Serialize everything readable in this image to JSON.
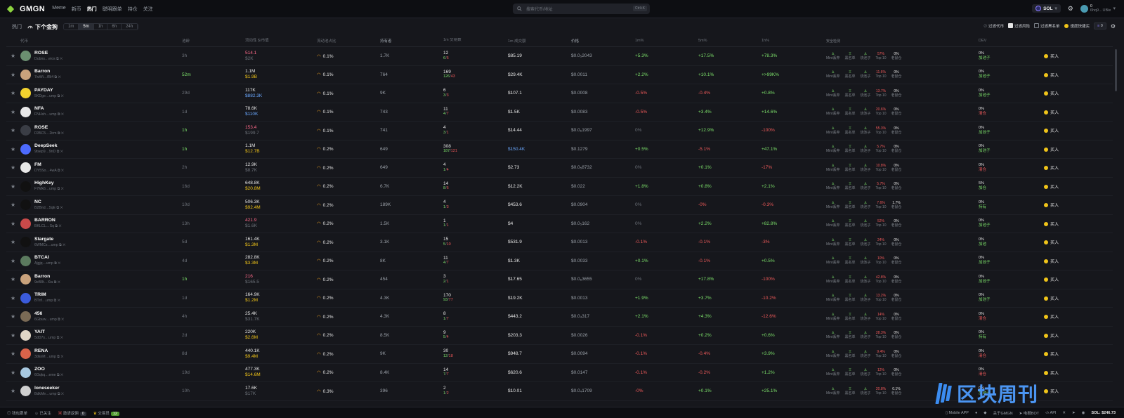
{
  "topbar": {
    "logo": "GMGN",
    "nav": [
      "Meme",
      "新币",
      "热门",
      "聪明跟单",
      "持仓",
      "关注"
    ],
    "active_nav": 2,
    "search_placeholder": "搜索代币/地址",
    "search_kbd": "Ctrl+K",
    "chain": "SOL",
    "wallet_value": "0",
    "wallet_addr": "6hq9…UBie"
  },
  "subbar": {
    "crumb": "热门",
    "title": "下个金狗",
    "timeframes": [
      "1m",
      "5m",
      "1h",
      "6h",
      "24h"
    ],
    "selected_tf": 1,
    "filters": [
      "过滤代币",
      "过滤风险",
      "过滤黑名单",
      "速度快捷买"
    ],
    "quick_buy_amount": "0"
  },
  "columns": [
    "代币",
    "池龄",
    "流动性 $/市值",
    "流动池占比",
    "持有者",
    "1m 交易数",
    "1m 成交额",
    "价格",
    "1m%",
    "5m%",
    "1h%",
    "安全检测",
    "DEV"
  ],
  "security_labels": [
    "Mint丢弃",
    "黑名单",
    "烧池子",
    "Top 10",
    "老鼠仓"
  ],
  "buy_label": "买入",
  "rows": [
    {
      "name": "ROSE",
      "addr": "Dubns…eios",
      "av": "#6b8f71",
      "age": "3h",
      "age_c": "muted",
      "liq": "514.1",
      "liq_c": "pink",
      "mc": "$2K",
      "mc_c": "muted",
      "pct": "0.1%",
      "holders": "1.7K",
      "tx": "12",
      "tx_b": "6",
      "tx_s": "6",
      "vol": "$85.19",
      "vol_c": "",
      "price": "$0.0₅2043",
      "p1": "+5.3%",
      "p1c": "green",
      "p5": "+17.5%",
      "p5c": "green",
      "p1h": "+78.3%",
      "p1hc": "green",
      "top10": "57%",
      "rat": "0%",
      "dev": "0%",
      "dev_s": "加池子",
      "dev_c": "green"
    },
    {
      "name": "Barron",
      "addr": "7wWt…fBi4",
      "av": "#c9a27c",
      "age": "52m",
      "age_c": "green",
      "liq": "1.1M",
      "liq_c": "",
      "mc": "$1.9B",
      "mc_c": "yellow",
      "pct": "0.1%",
      "holders": "764",
      "tx": "169",
      "tx_b": "126",
      "tx_s": "43",
      "vol": "$29.4K",
      "vol_c": "",
      "price": "$0.0011",
      "p1": "+2.2%",
      "p1c": "green",
      "p5": "+10.1%",
      "p5c": "green",
      "p1h": "+>99K%",
      "p1hc": "green",
      "top10": "11.6%",
      "rat": "0%",
      "dev": "0%",
      "dev_s": "加池子",
      "dev_c": "green"
    },
    {
      "name": "PAYDAY",
      "addr": "5KDge…ump",
      "av": "#f2d22e",
      "age": "29d",
      "age_c": "muted",
      "liq": "117K",
      "liq_c": "",
      "mc": "$882.3K",
      "mc_c": "blue",
      "pct": "0.1%",
      "holders": "9K",
      "tx": "6",
      "tx_b": "3",
      "tx_s": "3",
      "vol": "$107.1",
      "vol_c": "",
      "price": "$0.0008",
      "p1": "-0.5%",
      "p1c": "red",
      "p5": "-0.4%",
      "p5c": "red",
      "p1h": "+0.8%",
      "p1hc": "green",
      "top10": "13.7%",
      "rat": "0%",
      "dev": "0%",
      "dev_s": "加池子",
      "dev_c": "green"
    },
    {
      "name": "NFA",
      "addr": "FNHsh…ump",
      "av": "#e8e8e8",
      "age": "1d",
      "age_c": "muted",
      "liq": "78.6K",
      "liq_c": "",
      "mc": "$110K",
      "mc_c": "blue",
      "pct": "0.1%",
      "holders": "743",
      "tx": "11",
      "tx_b": "4",
      "tx_s": "7",
      "vol": "$1.5K",
      "vol_c": "",
      "price": "$0.0083",
      "p1": "-0.5%",
      "p1c": "red",
      "p5": "+3.4%",
      "p5c": "green",
      "p1h": "+14.6%",
      "p1hc": "green",
      "top10": "20.6%",
      "rat": "0%",
      "dev": "0%",
      "dev_s": "清仓",
      "dev_c": "red"
    },
    {
      "name": "ROSE",
      "addr": "D35C5…2irm",
      "av": "#3a3d45",
      "age": "1h",
      "age_c": "green",
      "liq": "153.4",
      "liq_c": "pink",
      "mc": "$199.7",
      "mc_c": "muted",
      "pct": "0.1%",
      "holders": "741",
      "tx": "4",
      "tx_b": "3",
      "tx_s": "1",
      "vol": "$14.44",
      "vol_c": "",
      "price": "$0.0₆1997",
      "p1": "0%",
      "p1c": "muted",
      "p5": "+12.9%",
      "p5c": "green",
      "p1h": "-100%",
      "p1hc": "red",
      "top10": "55.3%",
      "rat": "0%",
      "dev": "0%",
      "dev_s": "加池子",
      "dev_c": "green"
    },
    {
      "name": "DeepSeek",
      "addr": "9tsep9…9nD",
      "av": "#4d6bfe",
      "age": "1h",
      "age_c": "green",
      "liq": "1.1M",
      "liq_c": "",
      "mc": "$12.7B",
      "mc_c": "yellow",
      "pct": "0.2%",
      "holders": "649",
      "tx": "308",
      "tx_b": "187",
      "tx_s": "121",
      "vol": "$150.4K",
      "vol_c": "blue",
      "price": "$0.1279",
      "p1": "+0.5%",
      "p1c": "green",
      "p5": "-5.1%",
      "p5c": "red",
      "p1h": "+47.1%",
      "p1hc": "green",
      "top10": "5.7%",
      "rat": "0%",
      "dev": "0%",
      "dev_s": "加池子",
      "dev_c": "green"
    },
    {
      "name": "FM",
      "addr": "DY5So…4wA",
      "av": "#e8e8e8",
      "age": "2h",
      "age_c": "muted",
      "liq": "12.9K",
      "liq_c": "",
      "mc": "$8.7K",
      "mc_c": "muted",
      "pct": "0.2%",
      "holders": "649",
      "tx": "4",
      "tx_b": "1",
      "tx_s": "4",
      "vol": "$2.73",
      "vol_c": "",
      "price": "$0.0₅8732",
      "p1": "0%",
      "p1c": "muted",
      "p5": "+0.1%",
      "p5c": "green",
      "p1h": "-17%",
      "p1hc": "red",
      "top10": "10.8%",
      "rat": "0%",
      "dev": "0%",
      "dev_s": "清仓",
      "dev_c": "red"
    },
    {
      "name": "HighKey",
      "addr": "F7Mk6…ump",
      "av": "#111111",
      "age": "16d",
      "age_c": "muted",
      "liq": "648.8K",
      "liq_c": "",
      "mc": "$20.8M",
      "mc_c": "yellow",
      "pct": "0.2%",
      "holders": "6.7K",
      "tx": "14",
      "tx_b": "8",
      "tx_s": "6",
      "vol": "$12.2K",
      "vol_c": "",
      "price": "$0.022",
      "p1": "+1.8%",
      "p1c": "green",
      "p5": "+0.8%",
      "p5c": "green",
      "p1h": "+2.1%",
      "p1hc": "green",
      "top10": "5.7%",
      "rat": "0%",
      "dev": "5%",
      "dev_s": "加仓",
      "dev_c": "green"
    },
    {
      "name": "NC",
      "addr": "B2Bnd…5qE",
      "av": "#111111",
      "age": "10d",
      "age_c": "muted",
      "liq": "506.3K",
      "liq_c": "",
      "mc": "$92.4M",
      "mc_c": "yellow",
      "pct": "0.2%",
      "holders": "189K",
      "tx": "4",
      "tx_b": "1",
      "tx_s": "3",
      "vol": "$453.6",
      "vol_c": "",
      "price": "$0.0904",
      "p1": "0%",
      "p1c": "muted",
      "p5": "-0%",
      "p5c": "red",
      "p1h": "-0.3%",
      "p1hc": "red",
      "top10": "7.6%",
      "rat": "1.7%",
      "dev": "0%",
      "dev_s": "持有",
      "dev_c": "green"
    },
    {
      "name": "BARRON",
      "addr": "BKLCL…Sq",
      "av": "#c94a4a",
      "age": "13h",
      "age_c": "muted",
      "liq": "421.9",
      "liq_c": "pink",
      "mc": "$1.6K",
      "mc_c": "muted",
      "pct": "0.2%",
      "holders": "1.5K",
      "tx": "1",
      "tx_b": "1",
      "tx_s": "1",
      "vol": "$4",
      "vol_c": "",
      "price": "$0.0₅162",
      "p1": "0%",
      "p1c": "muted",
      "p5": "+2.2%",
      "p5c": "green",
      "p1h": "+82.8%",
      "p1hc": "green",
      "top10": "52%",
      "rat": "0%",
      "dev": "0%",
      "dev_s": "加池子",
      "dev_c": "green"
    },
    {
      "name": "Stargate",
      "addr": "6WMCs…ump",
      "av": "#111111",
      "age": "5d",
      "age_c": "muted",
      "liq": "161.4K",
      "liq_c": "",
      "mc": "$1.3M",
      "mc_c": "yellow",
      "pct": "0.2%",
      "holders": "3.1K",
      "tx": "15",
      "tx_b": "5",
      "tx_s": "10",
      "vol": "$531.9",
      "vol_c": "",
      "price": "$0.0013",
      "p1": "-0.1%",
      "p1c": "red",
      "p5": "-0.1%",
      "p5c": "red",
      "p1h": "-3%",
      "p1hc": "red",
      "top10": "24%",
      "rat": "0%",
      "dev": "0%",
      "dev_s": "加池",
      "dev_c": "green"
    },
    {
      "name": "BTCAI",
      "addr": "Ajgjq…ump",
      "av": "#5b7a5e",
      "age": "4d",
      "age_c": "muted",
      "liq": "282.8K",
      "liq_c": "",
      "mc": "$3.3M",
      "mc_c": "yellow",
      "pct": "0.2%",
      "holders": "8K",
      "tx": "11",
      "tx_b": "4",
      "tx_s": "7",
      "vol": "$1.3K",
      "vol_c": "",
      "price": "$0.0033",
      "p1": "+0.1%",
      "p1c": "green",
      "p5": "-0.1%",
      "p5c": "red",
      "p1h": "+0.5%",
      "p1hc": "green",
      "top10": "10%",
      "rat": "0%",
      "dev": "0%",
      "dev_s": "加池子",
      "dev_c": "green"
    },
    {
      "name": "Barron",
      "addr": "9eB8t…Xia",
      "av": "#c9a27c",
      "age": "1h",
      "age_c": "green",
      "liq": "216",
      "liq_c": "pink",
      "mc": "$165.5",
      "mc_c": "muted",
      "pct": "0.2%",
      "holders": "454",
      "tx": "3",
      "tx_b": "2",
      "tx_s": "1",
      "vol": "$17.65",
      "vol_c": "",
      "price": "$0.0₆3655",
      "p1": "0%",
      "p1c": "muted",
      "p5": "+17.8%",
      "p5c": "green",
      "p1h": "-100%",
      "p1hc": "red",
      "top10": "42.8%",
      "rat": "0%",
      "dev": "0%",
      "dev_s": "加池子",
      "dev_c": "green"
    },
    {
      "name": "TRIM",
      "addr": "BTnf…ump",
      "av": "#3b5bdb",
      "age": "1d",
      "age_c": "muted",
      "liq": "164.9K",
      "liq_c": "",
      "mc": "$1.2M",
      "mc_c": "yellow",
      "pct": "0.2%",
      "holders": "4.3K",
      "tx": "170",
      "tx_b": "93",
      "tx_s": "77",
      "vol": "$19.2K",
      "vol_c": "",
      "price": "$0.0013",
      "p1": "+1.9%",
      "p1c": "green",
      "p5": "+3.7%",
      "p5c": "green",
      "p1h": "-10.2%",
      "p1hc": "red",
      "top10": "13.2%",
      "rat": "0%",
      "dev": "0%",
      "dev_s": "加池子",
      "dev_c": "green"
    },
    {
      "name": "456",
      "addr": "6Gbuw…ump",
      "av": "#7a6a55",
      "age": "4h",
      "age_c": "muted",
      "liq": "25.4K",
      "liq_c": "",
      "mc": "$31.7K",
      "mc_c": "muted",
      "pct": "0.2%",
      "holders": "4.3K",
      "tx": "8",
      "tx_b": "1",
      "tx_s": "7",
      "vol": "$443.2",
      "vol_c": "",
      "price": "$0.0₄317",
      "p1": "+2.1%",
      "p1c": "green",
      "p5": "+4.3%",
      "p5c": "green",
      "p1h": "-12.6%",
      "p1hc": "red",
      "top10": "14%",
      "rat": "0%",
      "dev": "0%",
      "dev_s": "清仓",
      "dev_c": "red"
    },
    {
      "name": "YAIT",
      "addr": "5dD7s…ump",
      "av": "#e0d6c6",
      "age": "2d",
      "age_c": "muted",
      "liq": "220K",
      "liq_c": "",
      "mc": "$2.6M",
      "mc_c": "yellow",
      "pct": "0.2%",
      "holders": "8.5K",
      "tx": "9",
      "tx_b": "5",
      "tx_s": "4",
      "vol": "$203.3",
      "vol_c": "",
      "price": "$0.0026",
      "p1": "-0.1%",
      "p1c": "red",
      "p5": "+0.2%",
      "p5c": "green",
      "p1h": "+0.6%",
      "p1hc": "green",
      "top10": "28.3%",
      "rat": "0%",
      "dev": "0%",
      "dev_s": "持有",
      "dev_c": "green"
    },
    {
      "name": "RENA",
      "addr": "3dknM…ump",
      "av": "#d9634a",
      "age": "8d",
      "age_c": "muted",
      "liq": "440.1K",
      "liq_c": "",
      "mc": "$9.4M",
      "mc_c": "yellow",
      "pct": "0.2%",
      "holders": "9K",
      "tx": "30",
      "tx_b": "12",
      "tx_s": "18",
      "vol": "$948.7",
      "vol_c": "",
      "price": "$0.0094",
      "p1": "-0.1%",
      "p1c": "red",
      "p5": "-0.4%",
      "p5c": "red",
      "p1h": "+3.9%",
      "p1hc": "green",
      "top10": "9.4%",
      "rat": "0%",
      "dev": "0%",
      "dev_s": "清仓",
      "dev_c": "red"
    },
    {
      "name": "ZOO",
      "addr": "6Gqkq…eme",
      "av": "#a7c8e0",
      "age": "19d",
      "age_c": "muted",
      "liq": "477.3K",
      "liq_c": "",
      "mc": "$14.6M",
      "mc_c": "yellow",
      "pct": "0.2%",
      "holders": "8.4K",
      "tx": "14",
      "tx_b": "7",
      "tx_s": "7",
      "vol": "$620.6",
      "vol_c": "",
      "price": "$0.0147",
      "p1": "-0.1%",
      "p1c": "red",
      "p5": "-0.2%",
      "p5c": "red",
      "p1h": "+1.2%",
      "p1hc": "green",
      "top10": "12%",
      "rat": "0%",
      "dev": "0%",
      "dev_s": "清仓",
      "dev_c": "red"
    },
    {
      "name": "loneseeker",
      "addr": "BdkMe…ump",
      "av": "#cfcfcf",
      "age": "10h",
      "age_c": "muted",
      "liq": "17.6K",
      "liq_c": "",
      "mc": "$17K",
      "mc_c": "muted",
      "pct": "0.3%",
      "holders": "396",
      "tx": "2",
      "tx_b": "1",
      "tx_s": "2",
      "vol": "$10.01",
      "vol_c": "",
      "price": "$0.0₄1709",
      "p1": "-0%",
      "p1c": "red",
      "p5": "+0.1%",
      "p5c": "green",
      "p1h": "+25.1%",
      "p1hc": "green",
      "top10": "20.8%",
      "rat": "0.1%",
      "dev": "0%",
      "dev_s": "加池子",
      "dev_c": "green"
    }
  ],
  "footer": {
    "left": [
      "钱包跟单",
      "已关注",
      "邀请返佣",
      "交易员"
    ],
    "invite_count": "0",
    "trader_count": "12",
    "right": [
      "Mobile APP",
      "关于GMGN",
      "电报BOT",
      "API"
    ],
    "sol_price": "SOL: $246.73"
  },
  "watermark": "区块周刊"
}
